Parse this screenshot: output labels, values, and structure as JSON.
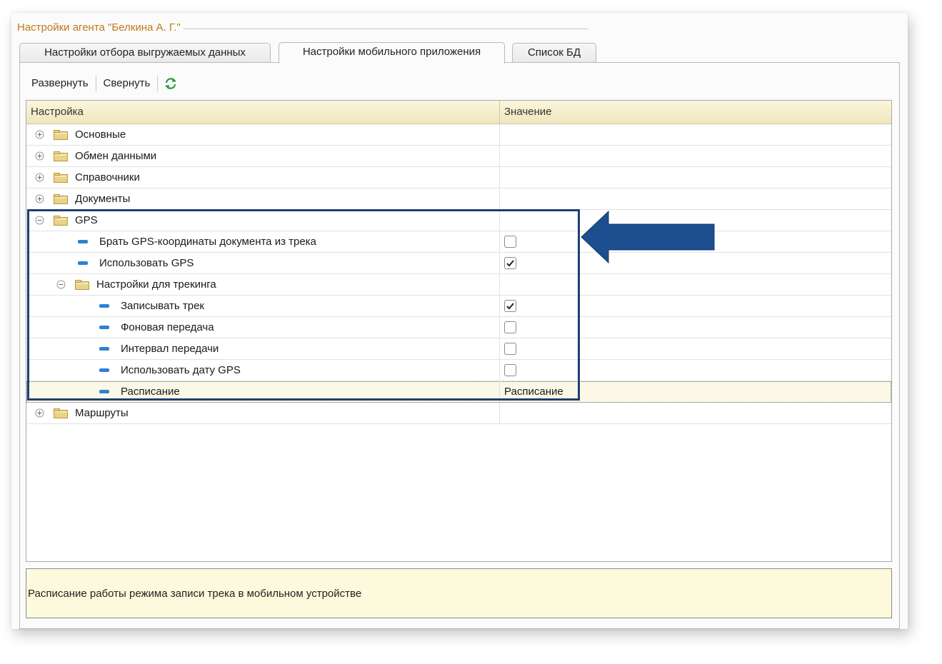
{
  "group": {
    "title": "Настройки агента \"Белкина А. Г.\""
  },
  "tabs": [
    {
      "label": "Настройки отбора выгружаемых данных",
      "active": false
    },
    {
      "label": "Настройки мобильного приложения",
      "active": true
    },
    {
      "label": "Список БД",
      "active": false
    }
  ],
  "toolbar": {
    "expand_label": "Развернуть",
    "collapse_label": "Свернуть",
    "refresh_icon": "refresh-icon"
  },
  "grid": {
    "columns": {
      "setting": "Настройка",
      "value": "Значение"
    },
    "rows": [
      {
        "label": "Основные",
        "type": "group",
        "expanded": false,
        "level": 0
      },
      {
        "label": "Обмен данными",
        "type": "group",
        "expanded": false,
        "level": 0
      },
      {
        "label": "Справочники",
        "type": "group",
        "expanded": false,
        "level": 0
      },
      {
        "label": "Документы",
        "type": "group",
        "expanded": false,
        "level": 0
      },
      {
        "label": "GPS",
        "type": "group",
        "expanded": true,
        "level": 0
      },
      {
        "label": "Брать GPS-координаты документа из трека",
        "type": "item",
        "level": 1,
        "checked": false
      },
      {
        "label": "Использовать GPS",
        "type": "item",
        "level": 1,
        "checked": true
      },
      {
        "label": "Настройки для трекинга",
        "type": "group",
        "expanded": true,
        "level": 1
      },
      {
        "label": "Записывать трек",
        "type": "item",
        "level": 2,
        "checked": true
      },
      {
        "label": "Фоновая передача",
        "type": "item",
        "level": 2,
        "checked": false
      },
      {
        "label": "Интервал передачи",
        "type": "item",
        "level": 2,
        "checked": false
      },
      {
        "label": "Использовать дату GPS",
        "type": "item",
        "level": 2,
        "checked": false
      },
      {
        "label": "Расписание",
        "type": "item",
        "level": 2,
        "value": "Расписание",
        "selected": true
      },
      {
        "label": "Маршруты",
        "type": "group",
        "expanded": false,
        "level": 0
      }
    ]
  },
  "description": "Расписание работы режима записи трека в мобильном устройстве",
  "colors": {
    "accent_title": "#c07a1a",
    "highlight_border": "#1d3f73",
    "arrow": "#1d4e8f",
    "leaf_marker": "#2f7fd6"
  }
}
